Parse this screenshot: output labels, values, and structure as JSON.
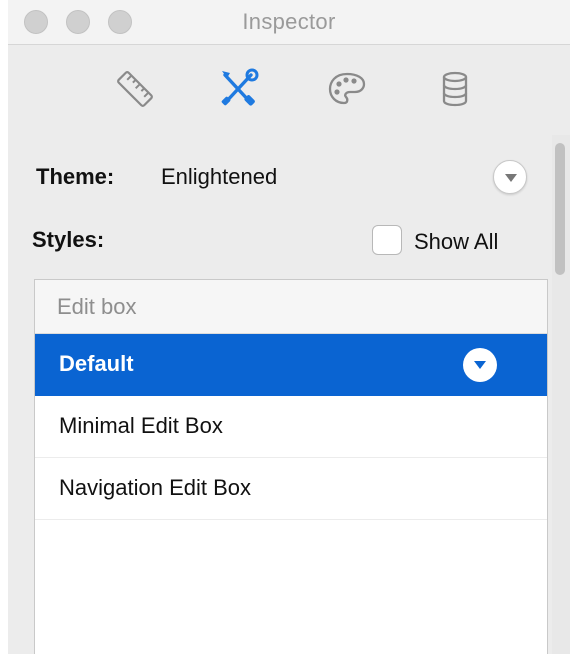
{
  "window": {
    "title": "Inspector"
  },
  "toolbar": {
    "tabs": [
      {
        "icon": "ruler-icon",
        "selected": false
      },
      {
        "icon": "tools-icon",
        "selected": true
      },
      {
        "icon": "palette-icon",
        "selected": false
      },
      {
        "icon": "database-icon",
        "selected": false
      }
    ],
    "accent_color": "#1f7ae0"
  },
  "theme": {
    "label": "Theme:",
    "value": "Enlightened"
  },
  "styles": {
    "label": "Styles:",
    "show_all_label": "Show All",
    "show_all_checked": false
  },
  "style_list": {
    "header": "Edit box",
    "items": [
      {
        "label": "Default",
        "selected": true
      },
      {
        "label": "Minimal Edit Box",
        "selected": false
      },
      {
        "label": "Navigation Edit Box",
        "selected": false
      }
    ],
    "selection_color": "#0a64d2"
  }
}
